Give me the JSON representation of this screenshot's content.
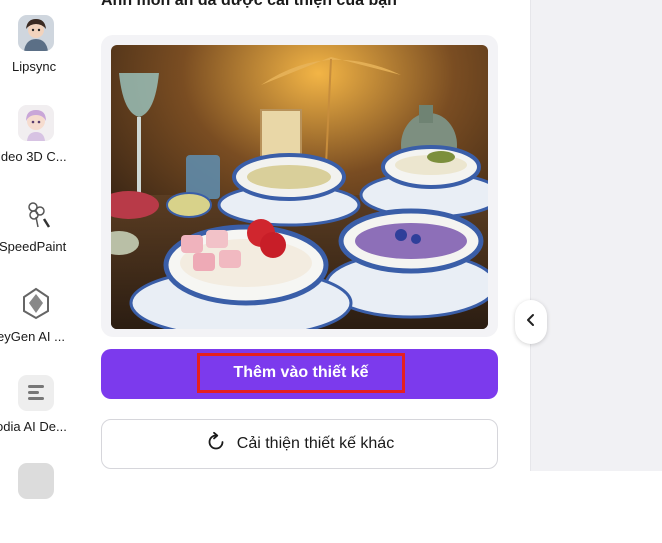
{
  "sidebar": {
    "items": [
      {
        "label": "Lipsync",
        "icon": "avatar-girl-icon"
      },
      {
        "label": "ideo 3D C...",
        "icon": "3d-avatar-icon"
      },
      {
        "label": "SpeedPaint",
        "icon": "flower-sketch-icon"
      },
      {
        "label": "eyGen AI ...",
        "icon": "heygen-logo-icon"
      },
      {
        "label": "odia AI De...",
        "icon": "stack-lines-icon"
      }
    ]
  },
  "panel": {
    "heading": "Ảnh món ăn đã được cải thiện của bạn",
    "primary_button": "Thêm vào thiết kế",
    "secondary_button": "Cải thiện thiết kế khác",
    "secondary_icon": "refresh-icon"
  },
  "colors": {
    "accent": "#7c3aed",
    "highlight_border": "#e52020",
    "right_area": "#f1f1f4"
  }
}
